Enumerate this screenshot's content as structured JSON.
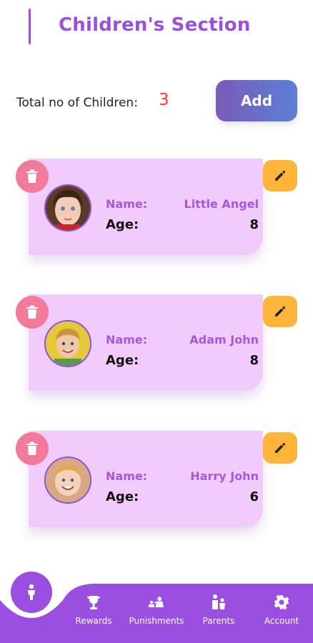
{
  "header": {
    "title": "Children's Section"
  },
  "summary": {
    "label": "Total no of Children:",
    "count": "3",
    "add_label": "Add"
  },
  "children": [
    {
      "name_label": "Name:",
      "name": "Little Angel",
      "age_label": "Age:",
      "age": "8"
    },
    {
      "name_label": "Name:",
      "name": "Adam John",
      "age_label": "Age:",
      "age": "8"
    },
    {
      "name_label": "Name:",
      "name": "Harry John",
      "age_label": "Age:",
      "age": "6"
    }
  ],
  "nav": {
    "items": [
      {
        "label": "Rewards",
        "icon": "trophy-icon"
      },
      {
        "label": "Punishments",
        "icon": "punishment-icon"
      },
      {
        "label": "Parents",
        "icon": "parents-icon"
      },
      {
        "label": "Account",
        "icon": "gear-icon"
      }
    ],
    "fab_icon": "child-icon"
  },
  "colors": {
    "accent": "#9b4fe0",
    "card": "#f0cbfb",
    "delete": "#f27a9a",
    "edit": "#ffb53a",
    "count": "#ff3b30"
  }
}
